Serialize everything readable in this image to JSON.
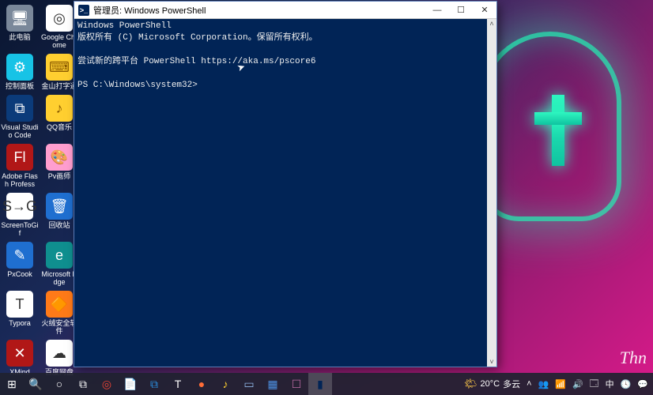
{
  "wallpaper": {
    "signature": "Thn"
  },
  "desktop_icons": [
    [
      {
        "id": "this-pc",
        "label": "此电脑",
        "glyph": "🖥",
        "bg": "bg-grey"
      },
      {
        "id": "chrome",
        "label": "Google Chrome",
        "glyph": "◎",
        "bg": "bg-white"
      }
    ],
    [
      {
        "id": "control-panel",
        "label": "控制面板",
        "glyph": "⚙",
        "bg": "bg-cyan"
      },
      {
        "id": "kingsoft-type",
        "label": "金山打字通",
        "glyph": "⌨",
        "bg": "bg-yellow"
      }
    ],
    [
      {
        "id": "vscode",
        "label": "Visual Studio Code",
        "glyph": "⧉",
        "bg": "bg-darkblue"
      },
      {
        "id": "qqmusic",
        "label": "QQ音乐",
        "glyph": "♪",
        "bg": "bg-yellow"
      }
    ],
    [
      {
        "id": "adobe-flash",
        "label": "Adobe Flash Professi…",
        "glyph": "Fl",
        "bg": "bg-red"
      },
      {
        "id": "pv",
        "label": "Pv画师",
        "glyph": "🎨",
        "bg": "bg-pink"
      }
    ],
    [
      {
        "id": "screentogif",
        "label": "ScreenToGif",
        "glyph": "S→G",
        "bg": "bg-white"
      },
      {
        "id": "recycle-bin",
        "label": "回收站",
        "glyph": "🗑",
        "bg": "bg-blue"
      }
    ],
    [
      {
        "id": "pxcook",
        "label": "PxCook",
        "glyph": "✎",
        "bg": "bg-blue"
      },
      {
        "id": "ms-edge",
        "label": "Microsoft Edge",
        "glyph": "e",
        "bg": "bg-teal"
      }
    ],
    [
      {
        "id": "typora",
        "label": "Typora",
        "glyph": "T",
        "bg": "bg-white"
      },
      {
        "id": "huorong",
        "label": "火绒安全软件",
        "glyph": "🔶",
        "bg": "bg-orange"
      }
    ],
    [
      {
        "id": "xmind",
        "label": "XMind",
        "glyph": "✕",
        "bg": "bg-red"
      },
      {
        "id": "baidu-netdisk",
        "label": "百度网盘",
        "glyph": "☁",
        "bg": "bg-white"
      }
    ]
  ],
  "powershell_window": {
    "title": "管理员: Windows PowerShell",
    "lines": [
      "Windows PowerShell",
      "版权所有 (C) Microsoft Corporation。保留所有权利。",
      "",
      "尝试新的跨平台 PowerShell https://aka.ms/pscore6",
      "",
      "PS C:\\Windows\\system32>"
    ],
    "controls": {
      "minimize": "—",
      "maximize": "☐",
      "close": "✕"
    },
    "scroll": {
      "up": "˄",
      "down": "˅"
    }
  },
  "taskbar": {
    "start_label": "开始",
    "search_label": "搜索",
    "cortana_label": "Cortana",
    "taskview_label": "任务视图",
    "pinned": [
      {
        "id": "chrome",
        "glyph": "◎",
        "color": "#ea4335"
      },
      {
        "id": "file",
        "glyph": "📄",
        "color": "#f3d38b"
      },
      {
        "id": "vscode",
        "glyph": "⧉",
        "color": "#2b8ede"
      },
      {
        "id": "typora",
        "glyph": "T",
        "color": "#ffffff"
      },
      {
        "id": "postman",
        "glyph": "●",
        "color": "#ff6c37"
      },
      {
        "id": "qqmusic",
        "glyph": "♪",
        "color": "#ffcf30"
      },
      {
        "id": "app1",
        "glyph": "▭",
        "color": "#8fb6e6"
      },
      {
        "id": "app2",
        "glyph": "▦",
        "color": "#4c8fe0"
      },
      {
        "id": "app3",
        "glyph": "☐",
        "color": "#b86aa2"
      },
      {
        "id": "powershell",
        "glyph": "▮",
        "color": "#012456",
        "active": true
      }
    ],
    "weather": {
      "temp": "20°C",
      "desc": "多云"
    },
    "tray": [
      {
        "id": "tray-chevron",
        "glyph": "˄"
      },
      {
        "id": "tray-people",
        "glyph": "👥"
      },
      {
        "id": "tray-network",
        "glyph": "📶"
      },
      {
        "id": "tray-volume",
        "glyph": "🔊"
      },
      {
        "id": "tray-battery",
        "glyph": "🗔"
      },
      {
        "id": "tray-ime",
        "glyph": "中"
      },
      {
        "id": "tray-clock",
        "glyph": "🕓"
      },
      {
        "id": "tray-action",
        "glyph": "💬"
      }
    ]
  }
}
